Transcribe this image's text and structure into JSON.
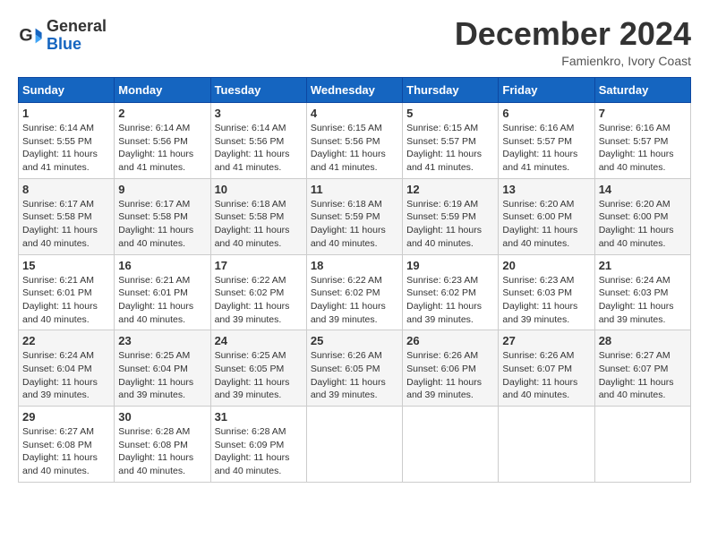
{
  "header": {
    "logo": {
      "general": "General",
      "blue": "Blue"
    },
    "title": "December 2024",
    "location": "Famienkro, Ivory Coast"
  },
  "weekdays": [
    "Sunday",
    "Monday",
    "Tuesday",
    "Wednesday",
    "Thursday",
    "Friday",
    "Saturday"
  ],
  "weeks": [
    [
      {
        "day": 1,
        "sunrise": "6:14 AM",
        "sunset": "5:55 PM",
        "daylight": "11 hours and 41 minutes."
      },
      {
        "day": 2,
        "sunrise": "6:14 AM",
        "sunset": "5:56 PM",
        "daylight": "11 hours and 41 minutes."
      },
      {
        "day": 3,
        "sunrise": "6:14 AM",
        "sunset": "5:56 PM",
        "daylight": "11 hours and 41 minutes."
      },
      {
        "day": 4,
        "sunrise": "6:15 AM",
        "sunset": "5:56 PM",
        "daylight": "11 hours and 41 minutes."
      },
      {
        "day": 5,
        "sunrise": "6:15 AM",
        "sunset": "5:57 PM",
        "daylight": "11 hours and 41 minutes."
      },
      {
        "day": 6,
        "sunrise": "6:16 AM",
        "sunset": "5:57 PM",
        "daylight": "11 hours and 41 minutes."
      },
      {
        "day": 7,
        "sunrise": "6:16 AM",
        "sunset": "5:57 PM",
        "daylight": "11 hours and 40 minutes."
      }
    ],
    [
      {
        "day": 8,
        "sunrise": "6:17 AM",
        "sunset": "5:58 PM",
        "daylight": "11 hours and 40 minutes."
      },
      {
        "day": 9,
        "sunrise": "6:17 AM",
        "sunset": "5:58 PM",
        "daylight": "11 hours and 40 minutes."
      },
      {
        "day": 10,
        "sunrise": "6:18 AM",
        "sunset": "5:58 PM",
        "daylight": "11 hours and 40 minutes."
      },
      {
        "day": 11,
        "sunrise": "6:18 AM",
        "sunset": "5:59 PM",
        "daylight": "11 hours and 40 minutes."
      },
      {
        "day": 12,
        "sunrise": "6:19 AM",
        "sunset": "5:59 PM",
        "daylight": "11 hours and 40 minutes."
      },
      {
        "day": 13,
        "sunrise": "6:20 AM",
        "sunset": "6:00 PM",
        "daylight": "11 hours and 40 minutes."
      },
      {
        "day": 14,
        "sunrise": "6:20 AM",
        "sunset": "6:00 PM",
        "daylight": "11 hours and 40 minutes."
      }
    ],
    [
      {
        "day": 15,
        "sunrise": "6:21 AM",
        "sunset": "6:01 PM",
        "daylight": "11 hours and 40 minutes."
      },
      {
        "day": 16,
        "sunrise": "6:21 AM",
        "sunset": "6:01 PM",
        "daylight": "11 hours and 40 minutes."
      },
      {
        "day": 17,
        "sunrise": "6:22 AM",
        "sunset": "6:02 PM",
        "daylight": "11 hours and 39 minutes."
      },
      {
        "day": 18,
        "sunrise": "6:22 AM",
        "sunset": "6:02 PM",
        "daylight": "11 hours and 39 minutes."
      },
      {
        "day": 19,
        "sunrise": "6:23 AM",
        "sunset": "6:02 PM",
        "daylight": "11 hours and 39 minutes."
      },
      {
        "day": 20,
        "sunrise": "6:23 AM",
        "sunset": "6:03 PM",
        "daylight": "11 hours and 39 minutes."
      },
      {
        "day": 21,
        "sunrise": "6:24 AM",
        "sunset": "6:03 PM",
        "daylight": "11 hours and 39 minutes."
      }
    ],
    [
      {
        "day": 22,
        "sunrise": "6:24 AM",
        "sunset": "6:04 PM",
        "daylight": "11 hours and 39 minutes."
      },
      {
        "day": 23,
        "sunrise": "6:25 AM",
        "sunset": "6:04 PM",
        "daylight": "11 hours and 39 minutes."
      },
      {
        "day": 24,
        "sunrise": "6:25 AM",
        "sunset": "6:05 PM",
        "daylight": "11 hours and 39 minutes."
      },
      {
        "day": 25,
        "sunrise": "6:26 AM",
        "sunset": "6:05 PM",
        "daylight": "11 hours and 39 minutes."
      },
      {
        "day": 26,
        "sunrise": "6:26 AM",
        "sunset": "6:06 PM",
        "daylight": "11 hours and 39 minutes."
      },
      {
        "day": 27,
        "sunrise": "6:26 AM",
        "sunset": "6:07 PM",
        "daylight": "11 hours and 40 minutes."
      },
      {
        "day": 28,
        "sunrise": "6:27 AM",
        "sunset": "6:07 PM",
        "daylight": "11 hours and 40 minutes."
      }
    ],
    [
      {
        "day": 29,
        "sunrise": "6:27 AM",
        "sunset": "6:08 PM",
        "daylight": "11 hours and 40 minutes."
      },
      {
        "day": 30,
        "sunrise": "6:28 AM",
        "sunset": "6:08 PM",
        "daylight": "11 hours and 40 minutes."
      },
      {
        "day": 31,
        "sunrise": "6:28 AM",
        "sunset": "6:09 PM",
        "daylight": "11 hours and 40 minutes."
      },
      null,
      null,
      null,
      null
    ]
  ]
}
